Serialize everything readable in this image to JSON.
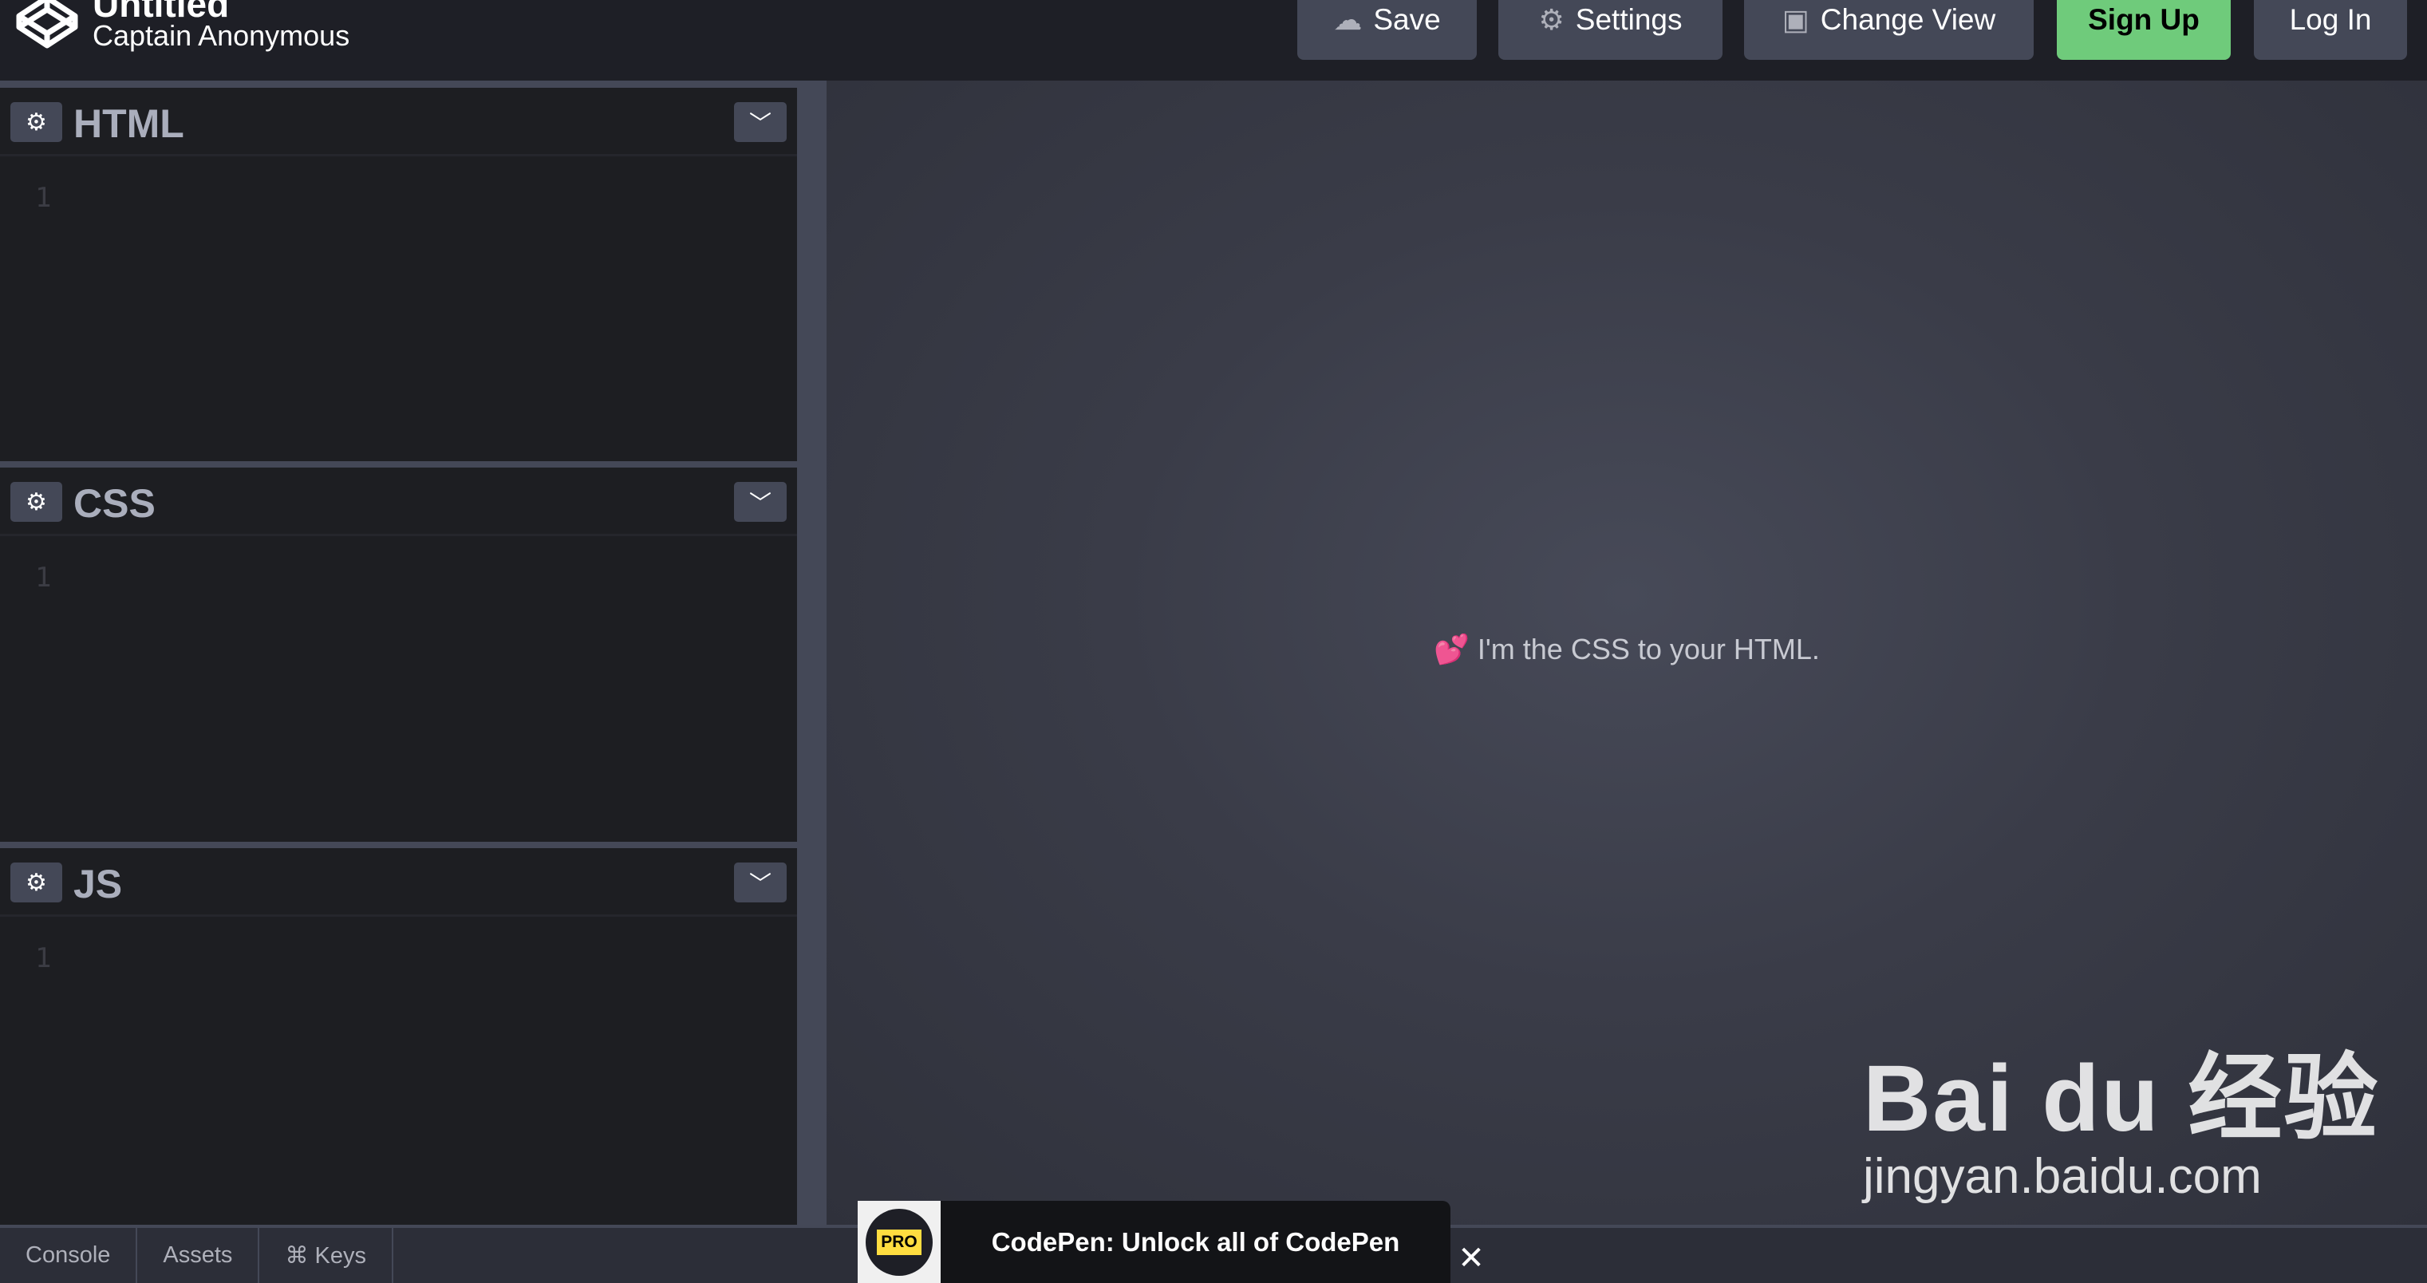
{
  "header": {
    "title": "Untitled",
    "author": "Captain Anonymous",
    "buttons": {
      "save": "Save",
      "settings": "Settings",
      "change_view": "Change View",
      "sign_up": "Sign Up",
      "log_in": "Log In"
    }
  },
  "editors": [
    {
      "name": "HTML",
      "line": "1"
    },
    {
      "name": "CSS",
      "line": "1"
    },
    {
      "name": "JS",
      "line": "1"
    }
  ],
  "preview": {
    "emoji": "💕",
    "text": "I'm the CSS to your HTML."
  },
  "footer": {
    "console": "Console",
    "assets": "Assets",
    "keys": "⌘ Keys"
  },
  "promo": {
    "badge": "PRO",
    "text": "CodePen: Unlock all of CodePen",
    "close": "✕"
  },
  "watermark": {
    "brand": "Bai du 经验",
    "url": "jingyan.baidu.com"
  },
  "colors": {
    "signup": "#6fcb7b",
    "button": "#444857",
    "background": "#1e1f26"
  }
}
